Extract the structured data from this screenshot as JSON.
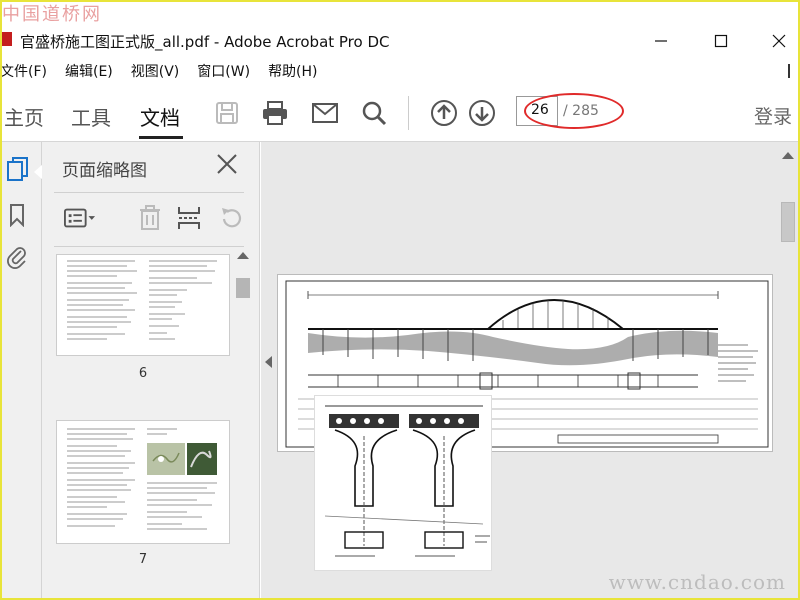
{
  "watermark": {
    "top": "中国道桥网",
    "bottom": "www.cndao.com"
  },
  "window": {
    "title": "官盛桥施工图正式版_all.pdf - Adobe Acrobat Pro DC",
    "controls": {
      "minimize": "—",
      "maximize": "☐",
      "close": "✕"
    }
  },
  "menu": [
    "文件(F)",
    "编辑(E)",
    "视图(V)",
    "窗口(W)",
    "帮助(H)"
  ],
  "toolbar": {
    "tabs": [
      {
        "label": "主页"
      },
      {
        "label": "工具"
      },
      {
        "label": "文档"
      }
    ],
    "active_tab": "文档",
    "page_current": "26",
    "page_total": "/ 285",
    "login": "登录"
  },
  "panel": {
    "title": "页面缩略图",
    "thumbnails": [
      {
        "label": "6"
      },
      {
        "label": "7"
      }
    ]
  },
  "colors": {
    "accent_blue": "#1a73c9",
    "annotation_red": "#e02a2a",
    "frame_yellow": "#e8e43a"
  }
}
